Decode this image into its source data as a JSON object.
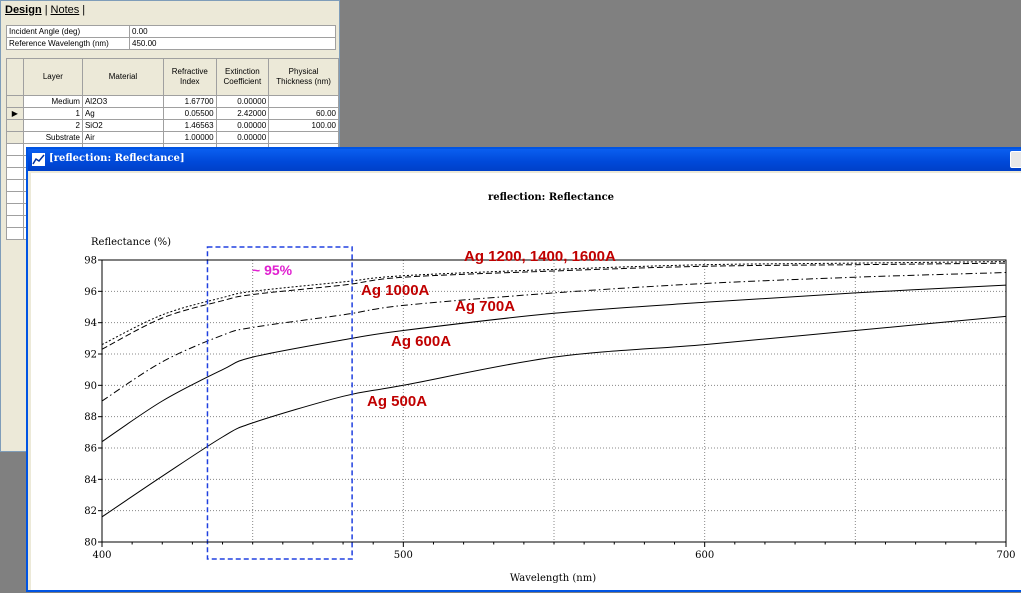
{
  "design_panel": {
    "tabs": [
      "Design",
      "Notes"
    ],
    "incident_angle_label": "Incident Angle (deg)",
    "incident_angle_value": "0.00",
    "ref_wavelength_label": "Reference Wavelength (nm)",
    "ref_wavelength_value": "450.00",
    "headers": {
      "layer": "Layer",
      "material": "Material",
      "refractive_index": "Refractive Index",
      "extinction_coefficient": "Extinction Coefficient",
      "physical_thickness": "Physical Thickness (nm)"
    },
    "rows": [
      {
        "layer": "Medium",
        "material": "Al2O3",
        "n": "1.67700",
        "k": "0.00000",
        "thickness": ""
      },
      {
        "layer": "1",
        "material": "Ag",
        "n": "0.05500",
        "k": "2.42000",
        "thickness": "60.00"
      },
      {
        "layer": "2",
        "material": "SiO2",
        "n": "1.46563",
        "k": "0.00000",
        "thickness": "100.00"
      },
      {
        "layer": "Substrate",
        "material": "Air",
        "n": "1.00000",
        "k": "0.00000",
        "thickness": ""
      }
    ]
  },
  "chart_window": {
    "title": "[reflection: Reflectance]"
  },
  "chart_data": {
    "type": "line",
    "title": "reflection: Reflectance",
    "ylabel": "Reflectance (%)",
    "xlabel": "Wavelength (nm)",
    "xlim": [
      400,
      700
    ],
    "ylim": [
      80,
      98
    ],
    "x_ticks": [
      400,
      500,
      600,
      700
    ],
    "y_ticks": [
      80,
      82,
      84,
      86,
      88,
      90,
      92,
      94,
      96,
      98
    ],
    "grid": true,
    "series": [
      {
        "style": "solid",
        "x": [
          400,
          420,
          440,
          450,
          480,
          500,
          550,
          600,
          650,
          700
        ],
        "values": [
          81.6,
          84.2,
          86.7,
          87.6,
          89.3,
          90.0,
          91.8,
          92.6,
          93.5,
          94.4
        ]
      },
      {
        "style": "solid",
        "x": [
          400,
          420,
          440,
          450,
          480,
          500,
          550,
          600,
          650,
          700
        ],
        "values": [
          86.4,
          89.0,
          91.0,
          91.8,
          92.9,
          93.5,
          94.6,
          95.3,
          95.9,
          96.4
        ]
      },
      {
        "style": "dashdot",
        "x": [
          400,
          420,
          440,
          450,
          480,
          500,
          550,
          600,
          650,
          700
        ],
        "values": [
          89.0,
          91.5,
          93.2,
          93.7,
          94.5,
          95.1,
          95.9,
          96.5,
          96.9,
          97.2
        ]
      },
      {
        "style": "dashed",
        "x": [
          400,
          420,
          440,
          450,
          480,
          500,
          550,
          600,
          650,
          700
        ],
        "values": [
          92.3,
          94.3,
          95.4,
          95.8,
          96.4,
          96.9,
          97.3,
          97.6,
          97.7,
          97.8
        ]
      },
      {
        "style": "dotted",
        "x": [
          400,
          420,
          440,
          450,
          480,
          500,
          550,
          600,
          650,
          700
        ],
        "values": [
          92.6,
          94.5,
          95.6,
          96.0,
          96.6,
          97.0,
          97.4,
          97.7,
          97.8,
          97.9
        ]
      }
    ],
    "annotations": [
      "Ag  1200, 1400, 1600A",
      "Ag  1000A",
      "Ag  700A",
      "Ag  600A",
      "Ag  500A",
      "~ 95%"
    ],
    "highlight_box": {
      "x_range": [
        435,
        483
      ],
      "style": "dashed",
      "color": "#2040e0"
    }
  }
}
